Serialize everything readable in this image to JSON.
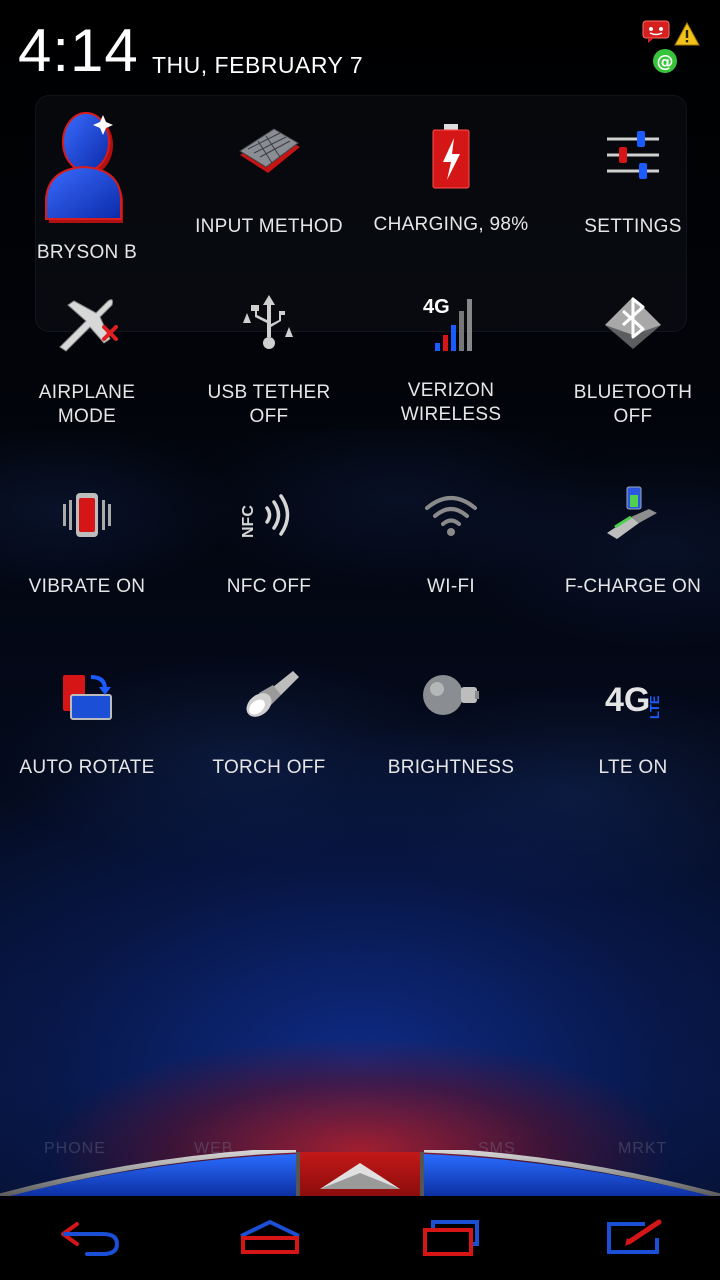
{
  "status": {
    "time": "4:14",
    "date": "THU, FEBRUARY 7",
    "notifications": [
      "message-icon",
      "warning-icon",
      "at-icon"
    ]
  },
  "tiles": [
    {
      "label": "BRYSON B",
      "icon": "user-icon"
    },
    {
      "label": "INPUT METHOD",
      "icon": "keyboard-icon"
    },
    {
      "label": "CHARGING, 98%",
      "icon": "battery-charging-icon"
    },
    {
      "label": "SETTINGS",
      "icon": "sliders-icon"
    },
    {
      "label": "AIRPLANE\nMODE",
      "icon": "airplane-icon"
    },
    {
      "label": "USB TETHER\nOFF",
      "icon": "usb-icon"
    },
    {
      "label": "VERIZON\nWIRELESS",
      "icon": "signal-4g-icon"
    },
    {
      "label": "BLUETOOTH\nOFF",
      "icon": "bluetooth-icon"
    },
    {
      "label": "VIBRATE ON",
      "icon": "vibrate-icon"
    },
    {
      "label": "NFC OFF",
      "icon": "nfc-icon"
    },
    {
      "label": "WI-FI",
      "icon": "wifi-icon"
    },
    {
      "label": "F-CHARGE ON",
      "icon": "fast-charge-icon"
    },
    {
      "label": "AUTO ROTATE",
      "icon": "rotate-icon"
    },
    {
      "label": "TORCH OFF",
      "icon": "flashlight-icon"
    },
    {
      "label": "BRIGHTNESS",
      "icon": "bulb-icon"
    },
    {
      "label": "LTE ON",
      "icon": "lte-icon"
    }
  ],
  "dock": {
    "labels": [
      "PHONE",
      "WEB",
      "SMS",
      "MRKT"
    ],
    "drawer_icon": "app-drawer-arrow-icon"
  },
  "navbar": {
    "buttons": [
      "back-icon",
      "home-icon",
      "recent-apps-icon",
      "menu-icon"
    ]
  },
  "colors": {
    "accent_red": "#d01818",
    "accent_blue": "#1a4fd6",
    "label_text": "#e6e6e6"
  }
}
